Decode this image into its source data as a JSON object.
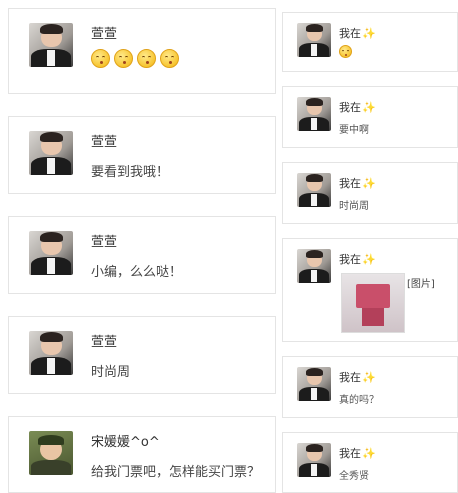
{
  "left_comments": [
    {
      "name": "萱萱",
      "text": "",
      "emoji_count": 4,
      "avatar": "man-lying-pillow"
    },
    {
      "name": "萱萱",
      "text": "要看到我哦！",
      "avatar": "man-lying-pillow"
    },
    {
      "name": "萱萱",
      "text": "小编，么么哒！",
      "avatar": "man-lying-pillow"
    },
    {
      "name": "萱萱",
      "text": "时尚周",
      "avatar": "man-lying-pillow"
    },
    {
      "name": "宋媛媛^o^",
      "text": "给我门票吧，怎样能买门票？",
      "avatar": "man-green-cap"
    }
  ],
  "right_replies": [
    {
      "name": "我在",
      "text": "",
      "has_emoji": true
    },
    {
      "name": "我在",
      "text": "要中啊"
    },
    {
      "name": "我在",
      "text": "时尚周"
    },
    {
      "name": "我在",
      "text": "",
      "image_label": "[图片]"
    },
    {
      "name": "我在",
      "text": "真的吗？"
    },
    {
      "name": "我在",
      "text": "全秀贤"
    }
  ],
  "sparkle_glyph": "✨"
}
